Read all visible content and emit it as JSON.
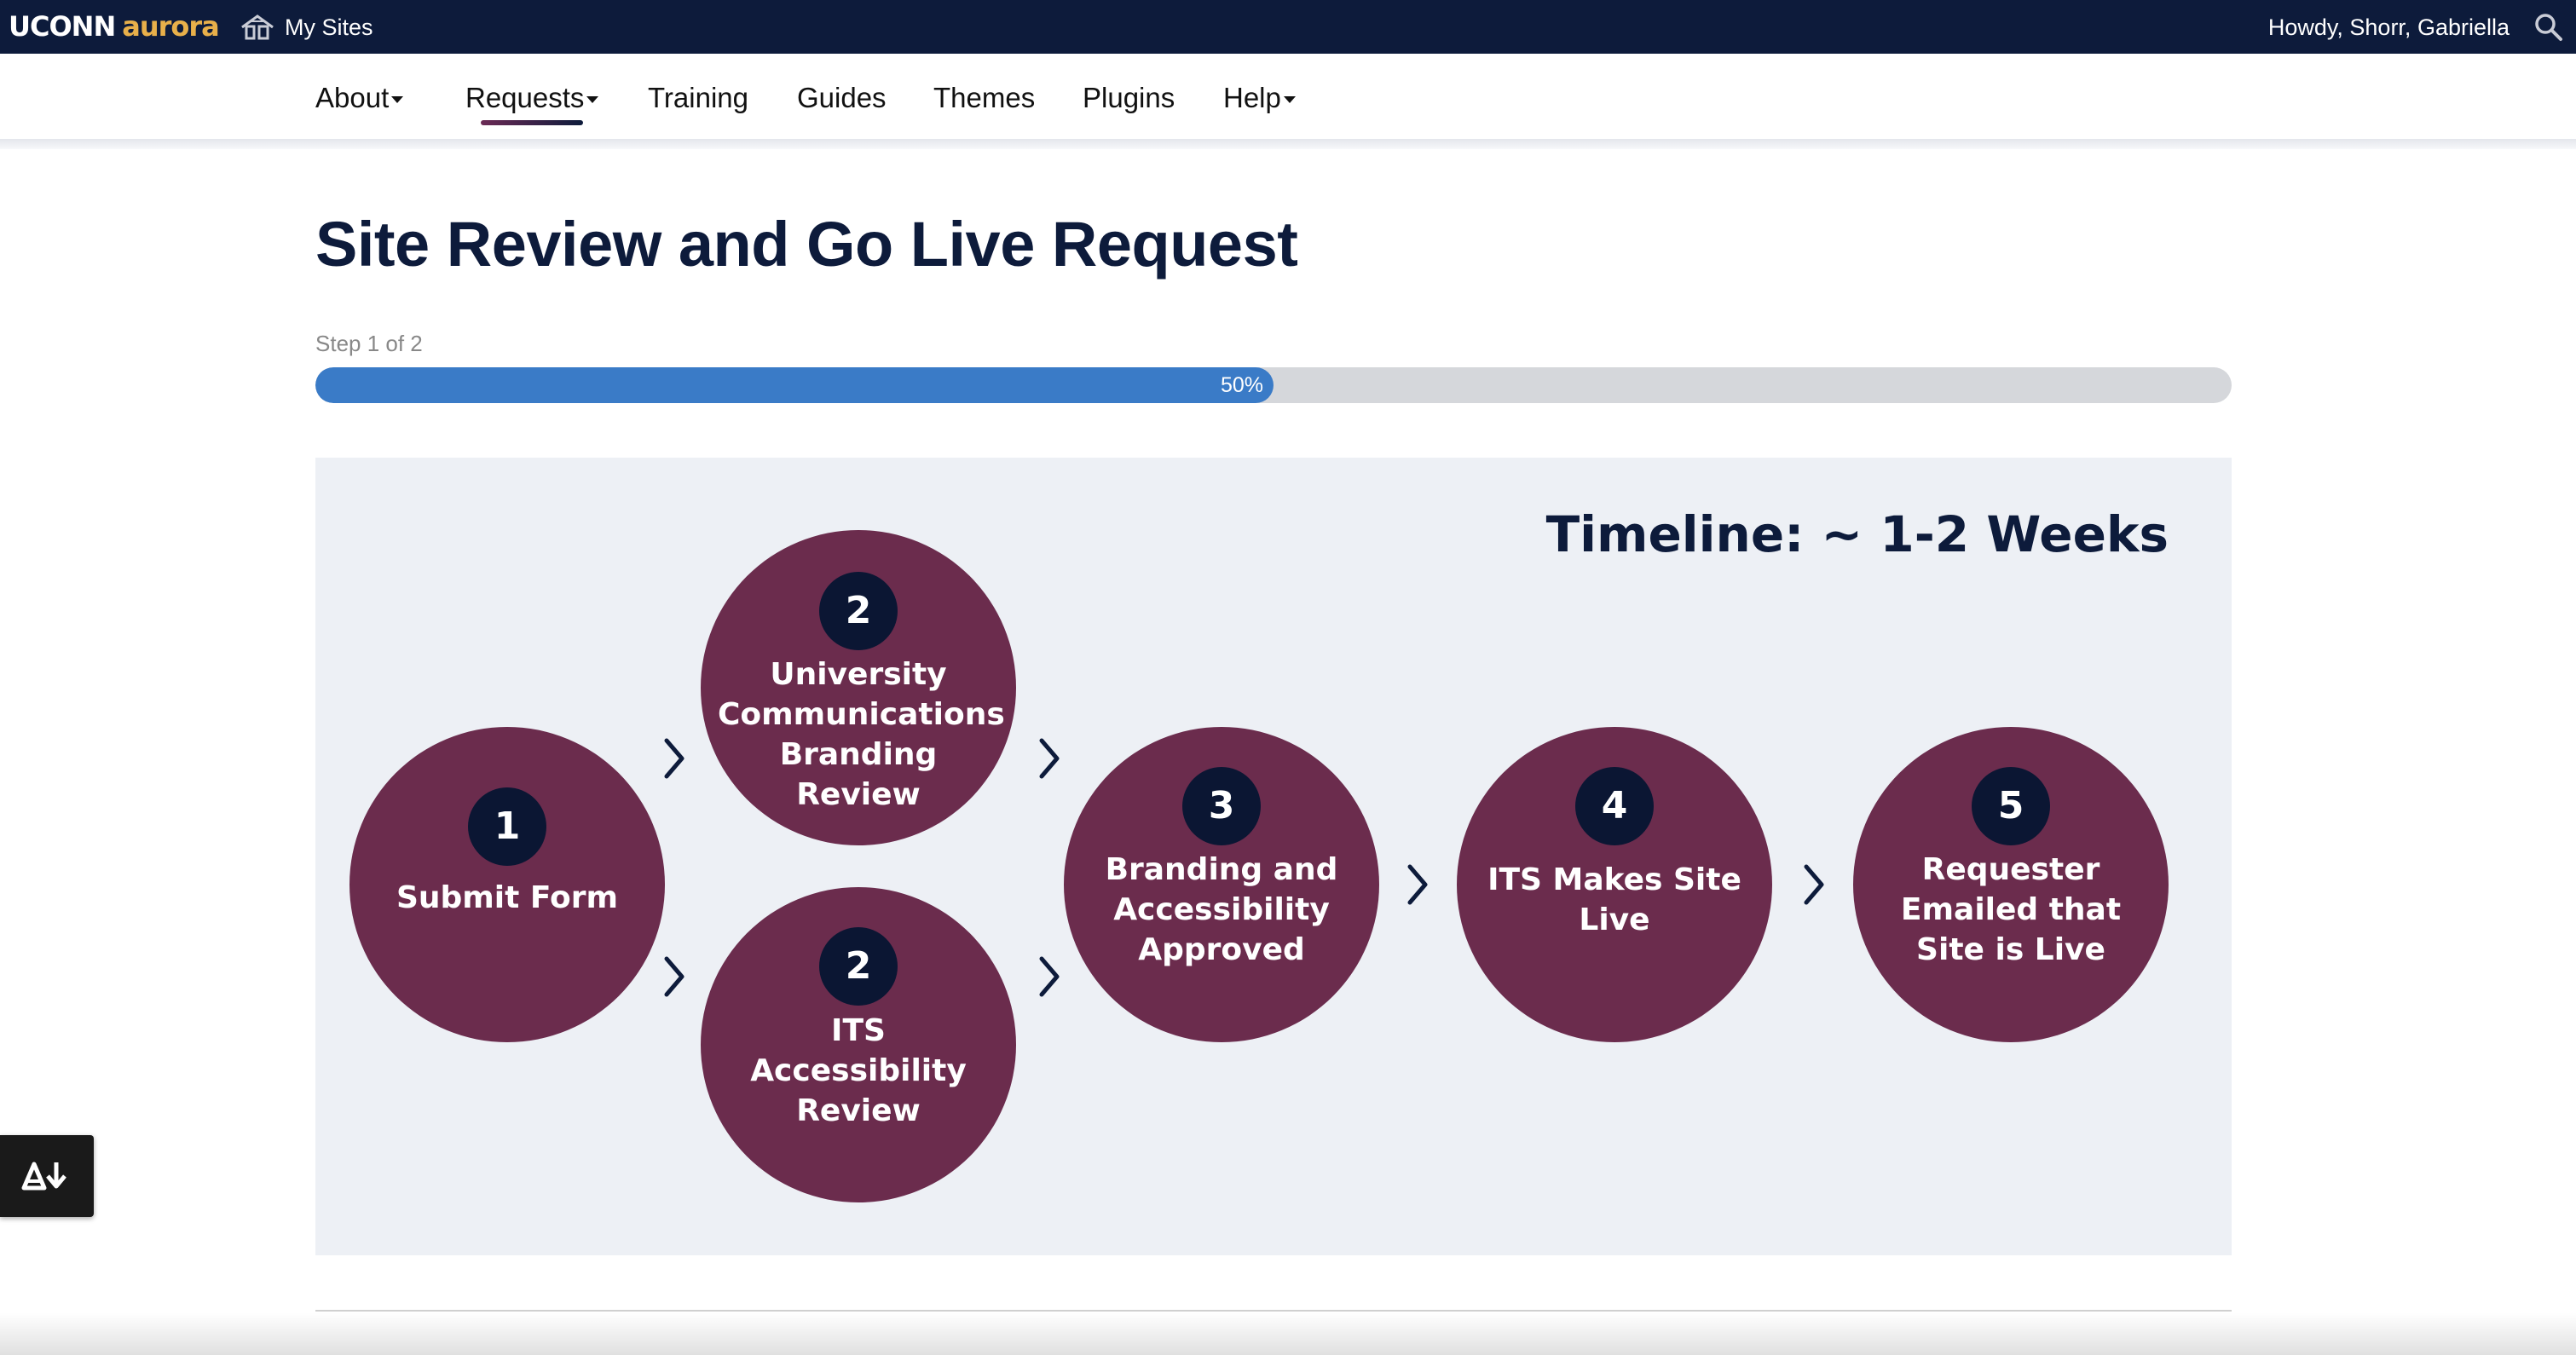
{
  "topbar": {
    "logo_uconn": "UCONN",
    "logo_aurora": "aurora",
    "my_sites": "My Sites",
    "howdy": "Howdy, Shorr, Gabriella"
  },
  "nav": {
    "items": [
      "About",
      "Requests",
      "Training",
      "Guides",
      "Themes",
      "Plugins",
      "Help"
    ],
    "active": "Requests"
  },
  "page": {
    "title": "Site Review and Go Live Request",
    "step_label": "Step 1 of 2",
    "progress_percent": 50,
    "progress_label": "50%"
  },
  "graphic": {
    "timeline": "Timeline: ~ 1-2 Weeks",
    "steps": [
      {
        "number": "1",
        "lines": [
          "Submit Form"
        ]
      },
      {
        "number": "2",
        "lines": [
          "University",
          "Communications",
          "Branding Review"
        ]
      },
      {
        "number": "2",
        "lines": [
          "ITS",
          "Accessibility",
          "Review"
        ]
      },
      {
        "number": "3",
        "lines": [
          "Branding and",
          "Accessibility",
          "Approved"
        ]
      },
      {
        "number": "4",
        "lines": [
          "ITS Makes Site",
          "Live"
        ]
      },
      {
        "number": "5",
        "lines": [
          "Requester",
          "Emailed that",
          "Site is Live"
        ]
      }
    ]
  },
  "colors": {
    "navy": "#0d1b3b",
    "maroon": "#6b2c4d",
    "progress_blue": "#3a7bc7",
    "gold": "#e8b04a"
  },
  "icons": {
    "my_sites": "my-sites-icon",
    "search": "search-icon",
    "accessibility": "accessibility-download-icon",
    "arrow": "chevron-right-icon"
  }
}
